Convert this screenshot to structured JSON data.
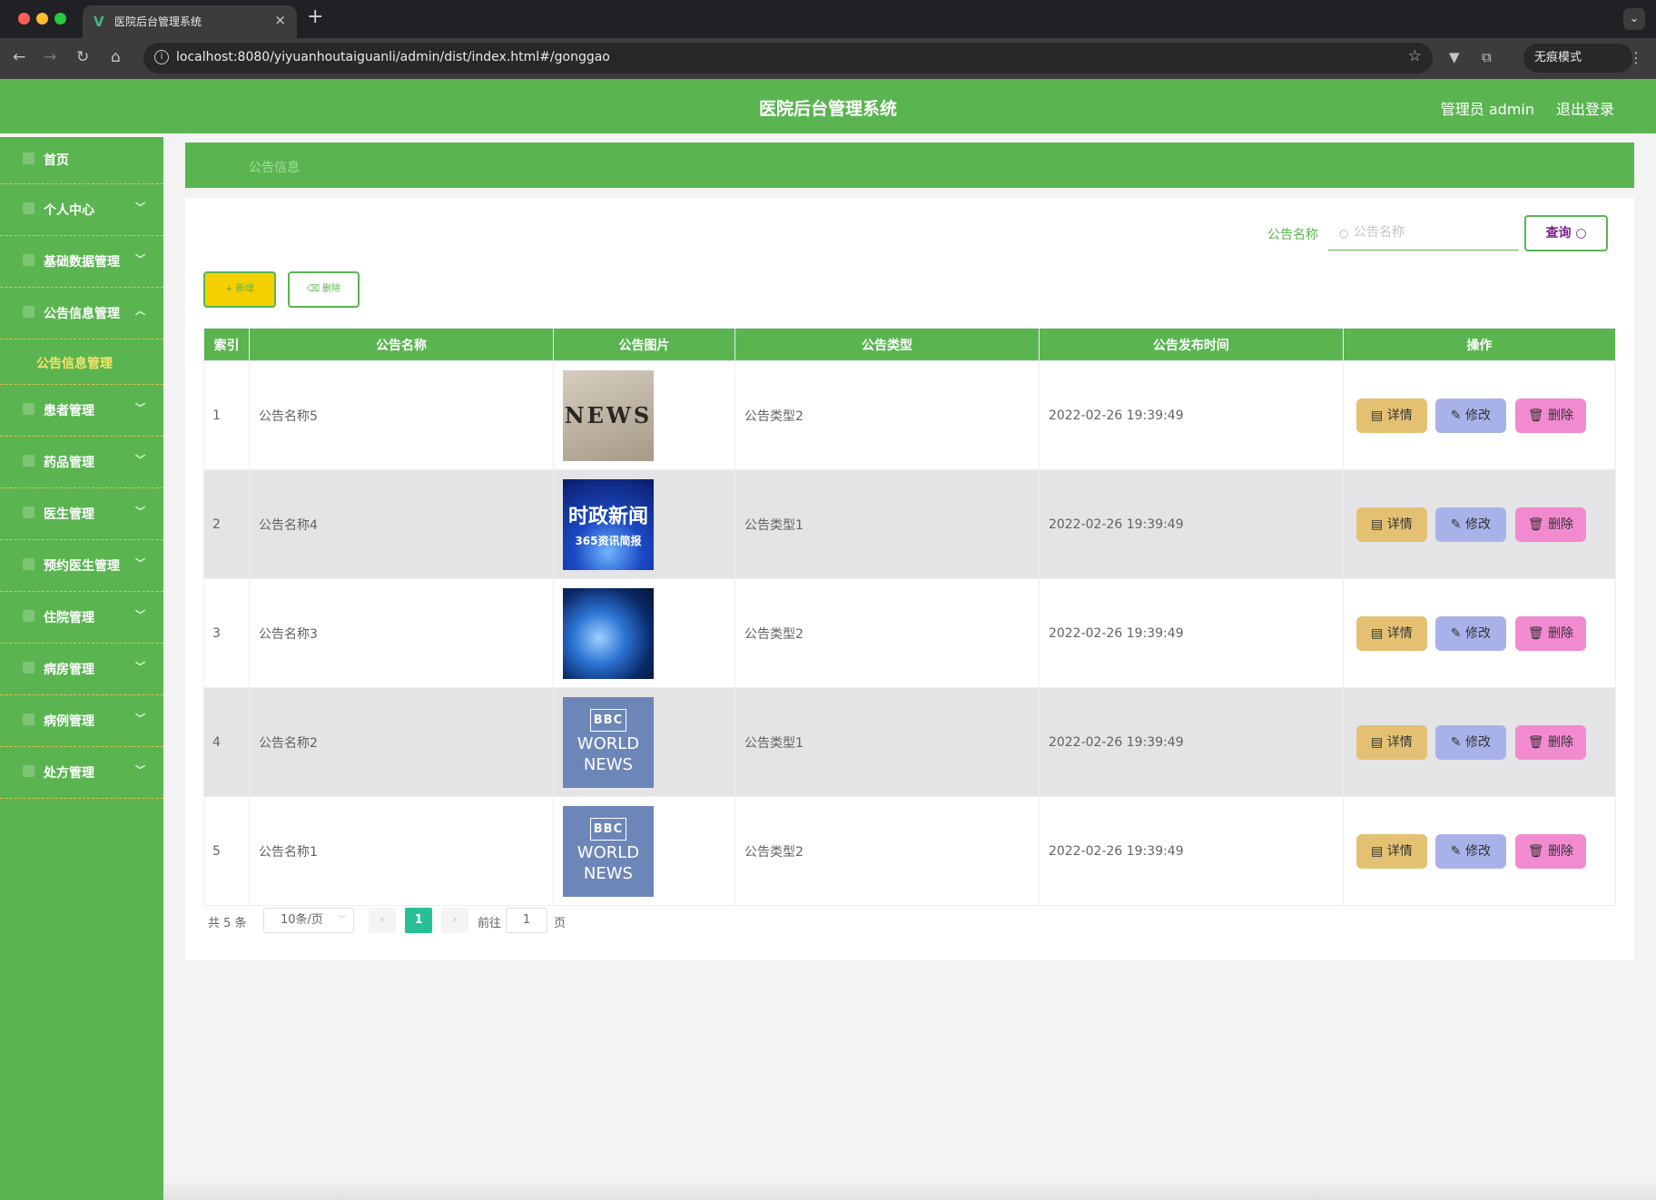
{
  "browser": {
    "tab_title": "医院后台管理系统",
    "url": "localhost:8080/yiyuanhoutaiguanli/admin/dist/index.html#/gonggao",
    "incognito_label": "无痕模式"
  },
  "header": {
    "title": "医院后台管理系统",
    "admin_label": "管理员 admin",
    "logout_label": "退出登录"
  },
  "sidebar": {
    "items": [
      {
        "label": "首页"
      },
      {
        "label": "个人中心"
      },
      {
        "label": "基础数据管理"
      },
      {
        "label": "公告信息管理"
      },
      {
        "label": "患者管理"
      },
      {
        "label": "药品管理"
      },
      {
        "label": "医生管理"
      },
      {
        "label": "预约医生管理"
      },
      {
        "label": "住院管理"
      },
      {
        "label": "病房管理"
      },
      {
        "label": "病例管理"
      },
      {
        "label": "处方管理"
      }
    ],
    "active_submenu": "公告信息管理"
  },
  "breadcrumb": "公告信息",
  "search": {
    "label": "公告名称",
    "placeholder": "公告名称",
    "button_label": "查询"
  },
  "actions": {
    "add_label": "新增",
    "delete_label": "删除"
  },
  "table": {
    "columns": [
      "索引",
      "公告名称",
      "公告图片",
      "公告类型",
      "公告发布时间",
      "操作"
    ],
    "rows": [
      {
        "index": "1",
        "name": "公告名称5",
        "image": "NEWS",
        "type": "公告类型2",
        "time": "2022-02-26 19:39:49"
      },
      {
        "index": "2",
        "name": "公告名称4",
        "image": "时政新闻",
        "type": "公告类型1",
        "time": "2022-02-26 19:39:49"
      },
      {
        "index": "3",
        "name": "公告名称3",
        "image": "globe",
        "type": "公告类型2",
        "time": "2022-02-26 19:39:49"
      },
      {
        "index": "4",
        "name": "公告名称2",
        "image": "BBC WORLD NEWS",
        "type": "公告类型1",
        "time": "2022-02-26 19:39:49"
      },
      {
        "index": "5",
        "name": "公告名称1",
        "image": "BBC WORLD NEWS",
        "type": "公告类型2",
        "time": "2022-02-26 19:39:49"
      }
    ],
    "op_labels": {
      "detail": "详情",
      "edit": "修改",
      "delete": "删除"
    }
  },
  "images": {
    "news_text": "NEWS",
    "shizheng_text": "时政新闻",
    "shizheng_sub": "365资讯简报",
    "bbc_logo": "BBC",
    "bbc_line1": "WORLD",
    "bbc_line2": "NEWS"
  },
  "pagination": {
    "total_text": "共 5 条",
    "page_size": "10条/页",
    "current_page": "1",
    "goto_label": "前往",
    "goto_value": "1",
    "page_suffix": "页"
  },
  "colors": {
    "primary_green": "#5ab551",
    "accent_yellow": "#f5d000",
    "detail_btn": "#e4c172",
    "edit_btn": "#a9b2e8",
    "delete_btn": "#f28ad0",
    "active_page": "#27c195"
  }
}
